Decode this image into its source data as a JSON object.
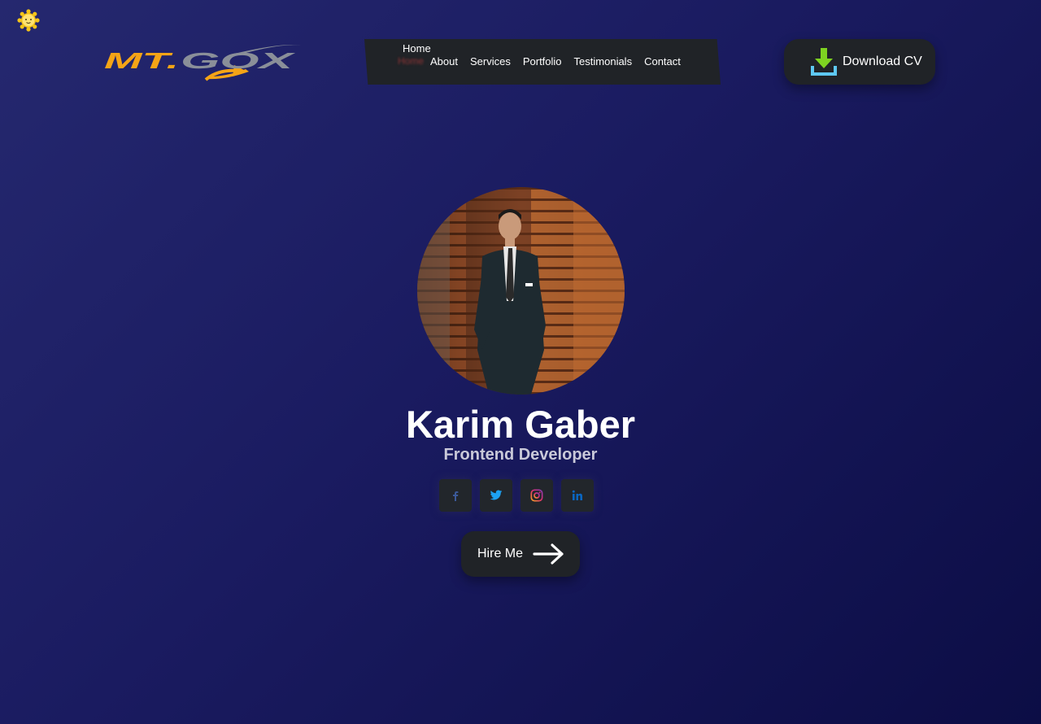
{
  "theme_toggle": {
    "icon": "sun-icon"
  },
  "logo": {
    "text": "MT.GOX",
    "colors": {
      "mt": "#f5a416",
      "gox": "#8a8f99"
    }
  },
  "nav": {
    "active": "Home",
    "home_shadow": "Home",
    "items": [
      {
        "label": "About"
      },
      {
        "label": "Services"
      },
      {
        "label": "Portfolio"
      },
      {
        "label": "Testimonials"
      },
      {
        "label": "Contact"
      }
    ]
  },
  "download_button": {
    "label": "Download CV",
    "icon": "download-icon"
  },
  "profile": {
    "name": "Karim Gaber",
    "role": "Frontend Developer"
  },
  "socials": [
    {
      "name": "facebook",
      "icon": "facebook-icon",
      "color": "#3b5998"
    },
    {
      "name": "twitter",
      "icon": "twitter-icon",
      "color": "#1da1f2"
    },
    {
      "name": "instagram",
      "icon": "instagram-icon",
      "color": "#e1306c"
    },
    {
      "name": "linkedin",
      "icon": "linkedin-icon",
      "color": "#0a66c2"
    }
  ],
  "hire_button": {
    "label": "Hire Me",
    "icon": "arrow-right-icon"
  },
  "colors": {
    "bg_start": "#25286f",
    "bg_end": "#0c0d45",
    "panel": "#202327",
    "accent_green": "#7ed321",
    "accent_blue": "#5ec8f2"
  }
}
